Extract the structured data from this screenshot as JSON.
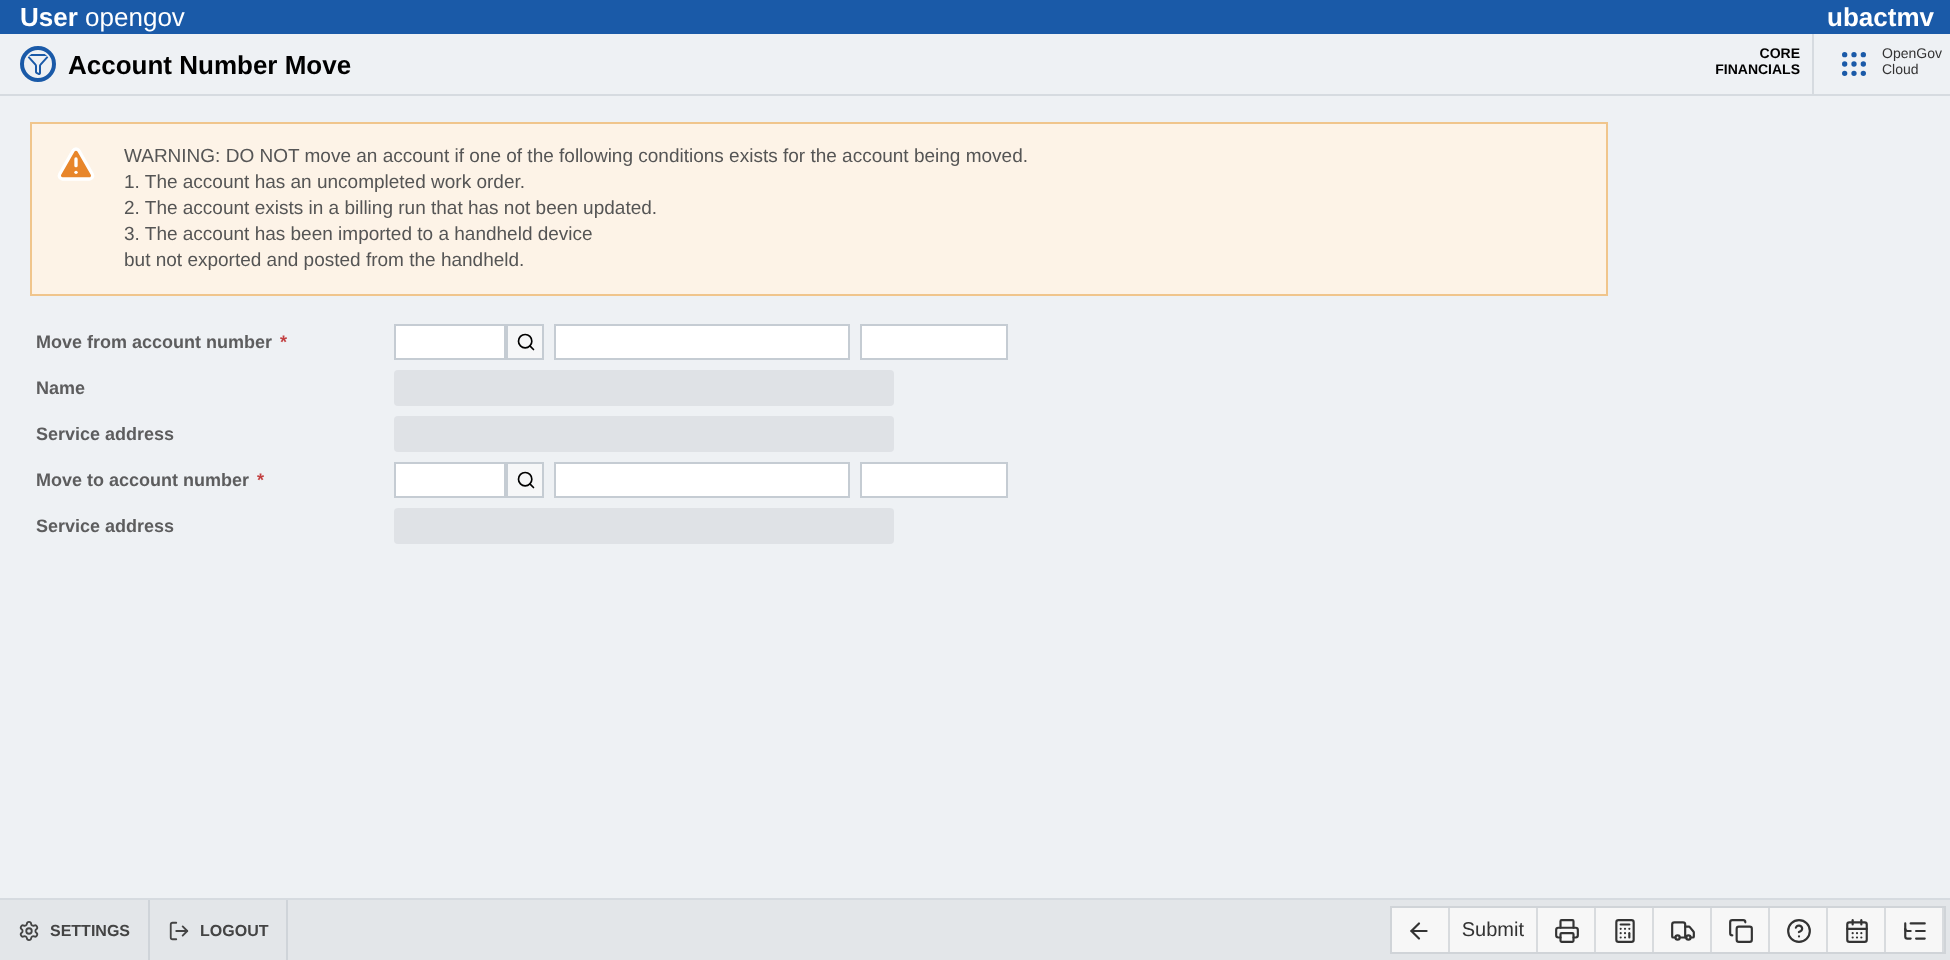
{
  "top_bar": {
    "user_label": "User",
    "user": "opengov",
    "code": "ubactmv"
  },
  "header": {
    "title": "Account Number Move",
    "product": [
      "CORE",
      "FINANCIALS"
    ],
    "cloud": [
      "OpenGov",
      "Cloud"
    ]
  },
  "warning": {
    "lines": [
      "WARNING: DO NOT move an account if one of the following conditions exists for the account being moved.",
      "1. The account has an uncompleted work order.",
      "2. The account exists in a billing run that has not been updated.",
      "3. The account has been imported to a handheld device",
      "but not exported and posted from the handheld."
    ]
  },
  "required_marker": "*",
  "form": [
    {
      "kind": "lookup",
      "label": "Move from account number",
      "required": true
    },
    {
      "kind": "readonly",
      "label": "Name",
      "required": false
    },
    {
      "kind": "readonly",
      "label": "Service address",
      "required": false
    },
    {
      "kind": "lookup",
      "label": "Move to account number",
      "required": true
    },
    {
      "kind": "readonly",
      "label": "Service address",
      "required": false
    }
  ],
  "footer": {
    "left": [
      {
        "kind": "settings",
        "label": "SETTINGS"
      },
      {
        "kind": "logout",
        "label": "LOGOUT"
      }
    ],
    "toolbar": [
      {
        "kind": "back"
      },
      {
        "kind": "text",
        "label": "Submit"
      },
      {
        "kind": "print"
      },
      {
        "kind": "calculator"
      },
      {
        "kind": "truck"
      },
      {
        "kind": "copy"
      },
      {
        "kind": "help"
      },
      {
        "kind": "calendar"
      },
      {
        "kind": "tree"
      }
    ]
  }
}
